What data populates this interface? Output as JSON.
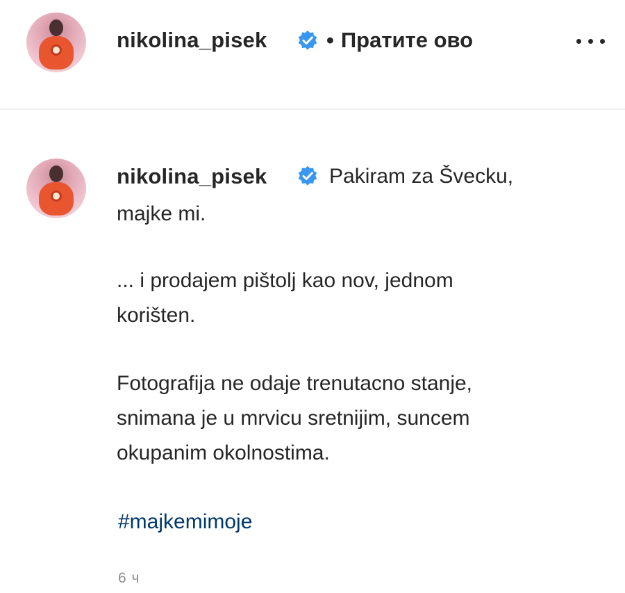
{
  "header": {
    "username": "nikolina_pisek",
    "follow_label": "Пратите ово",
    "separator": "•"
  },
  "caption": {
    "username": "nikolina_pisek",
    "line1": "Pakiram za Švecku,",
    "line2": "majke mi.",
    "line3": "... i prodajem pištolj kao nov, jednom",
    "line4": "korišten.",
    "line5": "Fotografija ne odaje trenutacno stanje,",
    "line6": "snimana je u mrvicu sretnijim, suncem",
    "line7": "okupanim okolnostima.",
    "hashtag": "#majkemimoje",
    "timestamp": "6 ч"
  },
  "colors": {
    "text": "#262626",
    "verified": "#3897f0",
    "link": "#00376b",
    "muted": "#8e8e8e",
    "divider": "#efefef"
  },
  "icons": {
    "verified": "verified-badge-icon",
    "more": "more-options-icon"
  }
}
